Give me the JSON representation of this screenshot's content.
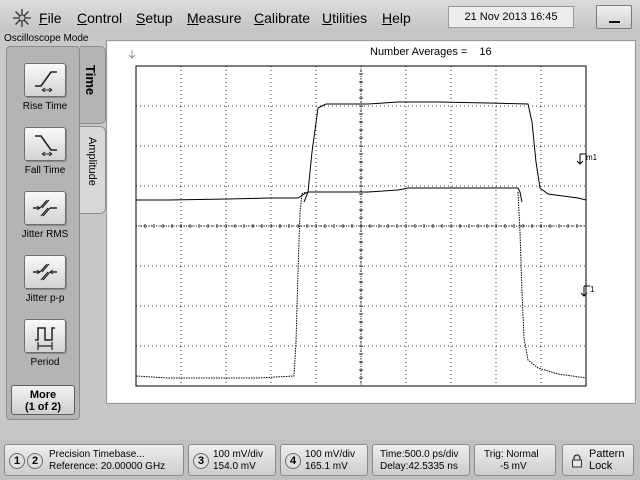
{
  "menu": {
    "items": [
      "File",
      "Control",
      "Setup",
      "Measure",
      "Calibrate",
      "Utilities",
      "Help"
    ],
    "datetime": "21 Nov 2013   16:45",
    "logo_icon": "starburst-logo-icon",
    "minimize_icon": "minimize-icon"
  },
  "mode_label": "Oscilloscope Mode",
  "sidebar": {
    "buttons": [
      {
        "label": "Rise Time",
        "icon": "rise-time-icon"
      },
      {
        "label": "Fall Time",
        "icon": "fall-time-icon"
      },
      {
        "label": "Jitter RMS",
        "icon": "jitter-rms-icon"
      },
      {
        "label": "Jitter p-p",
        "icon": "jitter-pp-icon"
      },
      {
        "label": "Period",
        "icon": "period-icon"
      }
    ],
    "more_line1": "More",
    "more_line2": "(1 of 2)"
  },
  "tabs": {
    "time": "Time",
    "amplitude": "Amplitude"
  },
  "display": {
    "averages_label": "Number Averages =",
    "averages_value": "16",
    "marker_m1": "m1",
    "marker_1": "1",
    "trace_color": "#000000",
    "grid_color": "#000000",
    "background": "#ffffff"
  },
  "status": {
    "ch12_num1": "1",
    "ch12_num2": "2",
    "timebase_line1": "Precision Timebase...",
    "timebase_line2": "Reference: 20.00000 GHz",
    "ch3_num": "3",
    "ch3_line1": "100 mV/div",
    "ch3_line2": "154.0 mV",
    "ch4_num": "4",
    "ch4_line1": "100 mV/div",
    "ch4_line2": "165.1 mV",
    "time_line1": "Time:500.0 ps/div",
    "time_line2": "Delay:42.5335 ns",
    "trig_line1": "Trig: Normal",
    "trig_line2": "-5 mV",
    "pattern_line1": "Pattern",
    "pattern_line2": "Lock"
  }
}
